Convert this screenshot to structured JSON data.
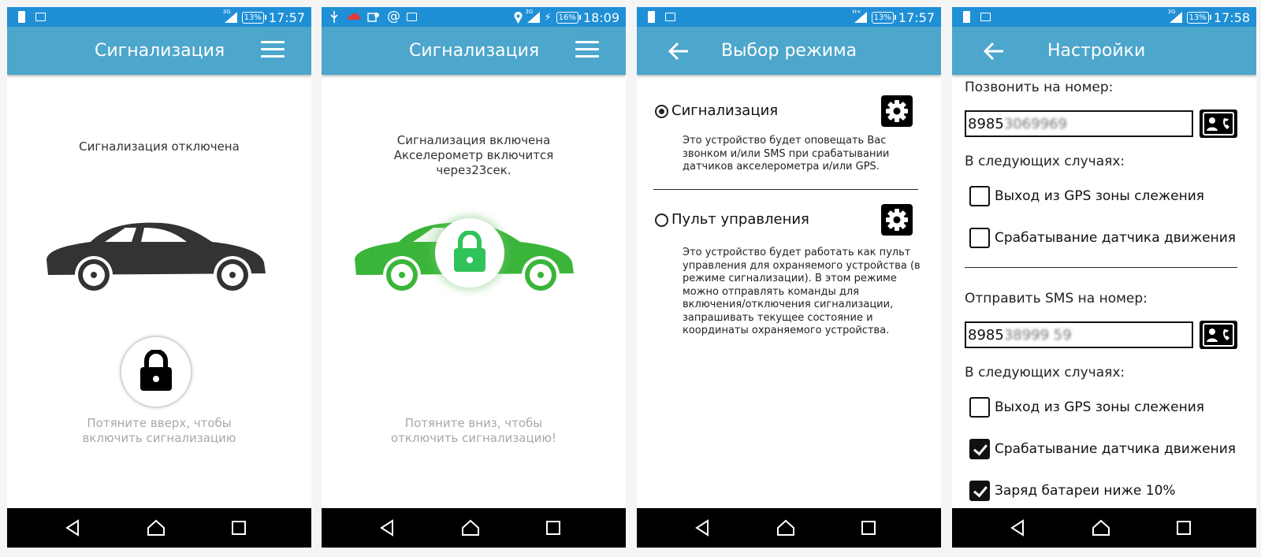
{
  "status": {
    "s1": {
      "time": "17:57",
      "net": "3G",
      "battery": "13%"
    },
    "s2": {
      "time": "18:09",
      "net": "3G",
      "battery": "16%"
    },
    "s3": {
      "time": "17:57",
      "net": "H+",
      "battery": "13%"
    },
    "s4": {
      "time": "17:58",
      "net": "3G",
      "battery": "13%"
    }
  },
  "screen1": {
    "title": "Сигнализация",
    "status_text": "Сигнализация отключена",
    "hint_line1": "Потяните вверх, чтобы",
    "hint_line2": "включить сигнализацию",
    "car_color": "#333333"
  },
  "screen2": {
    "title": "Сигнализация",
    "status_line1": "Сигнализация включена",
    "status_line2": "Акселерометр включится",
    "status_line3": "через23сек.",
    "hint_line1": "Потяните вниз, чтобы",
    "hint_line2": "отключить сигнализацию!",
    "car_color": "#3ab53a"
  },
  "screen3": {
    "title": "Выбор режима",
    "options": [
      {
        "label": "Сигнализация",
        "selected": true,
        "desc": [
          "Это устройство будет оповещать Вас",
          "звонком и/или SMS при срабатывании",
          "датчиков акселерометра и/или GPS."
        ]
      },
      {
        "label": "Пульт управления",
        "selected": false,
        "desc": [
          "Это устройство будет работать как пульт",
          "управления для охраняемого устройства (в",
          "режиме сигнализации). В этом режиме",
          "можно отправлять команды для",
          "включения/отключения сигнализации,",
          "запрашивать текущее состояние и",
          "координаты охраняемого устройства."
        ]
      }
    ]
  },
  "screen4": {
    "title": "Настройки",
    "call_label": "Позвонить на номер:",
    "call_number_prefix": "8985",
    "call_number_hidden": "3069969",
    "cases_label_1": "В следующих случаях:",
    "call_cases": [
      {
        "label": "Выход из GPS зоны слежения",
        "checked": false
      },
      {
        "label": "Срабатывание датчика движения",
        "checked": false
      }
    ],
    "sms_label": "Отправить SMS на номер:",
    "sms_number_prefix": "8985",
    "sms_number_hidden": "38999 59",
    "cases_label_2": "В следующих случаях:",
    "sms_cases": [
      {
        "label": "Выход из GPS зоны слежения",
        "checked": false
      },
      {
        "label": "Срабатывание датчика движения",
        "checked": true
      },
      {
        "label": "Заряд батареи ниже 10%",
        "checked": true
      }
    ]
  },
  "colors": {
    "status_bar": "#1f8fd6",
    "toolbar": "#4da6cc",
    "nav_bar": "#000000"
  }
}
